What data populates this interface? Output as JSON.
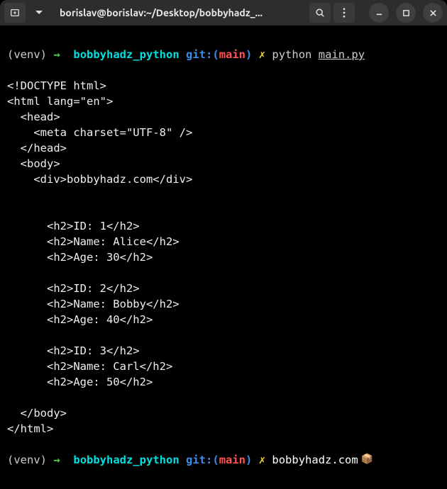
{
  "titlebar": {
    "title": "borislav@borislav:~/Desktop/bobbyhadz_..."
  },
  "prompt1": {
    "venv": "(venv)",
    "arrow": "→",
    "dir": "bobbyhadz_python",
    "git_label": "git:(",
    "branch": "main",
    "git_close": ")",
    "x": "✗",
    "command": "python",
    "file": "main.py"
  },
  "output_lines": [
    "<!DOCTYPE html>",
    "<html lang=\"en\">",
    "  <head>",
    "    <meta charset=\"UTF-8\" />",
    "  </head>",
    "  <body>",
    "    <div>bobbyhadz.com</div>",
    "",
    "    ",
    "      <h2>ID: 1</h2>",
    "      <h2>Name: Alice</h2>",
    "      <h2>Age: 30</h2>",
    "    ",
    "      <h2>ID: 2</h2>",
    "      <h2>Name: Bobby</h2>",
    "      <h2>Age: 40</h2>",
    "    ",
    "      <h2>ID: 3</h2>",
    "      <h2>Name: Carl</h2>",
    "      <h2>Age: 50</h2>",
    "    ",
    "  </body>",
    "</html>"
  ],
  "prompt2": {
    "venv": "(venv)",
    "arrow": "→",
    "dir": "bobbyhadz_python",
    "git_label": "git:(",
    "branch": "main",
    "git_close": ")",
    "x": "✗"
  },
  "watermark": {
    "text": "bobbyhadz.com",
    "cube": "📦"
  }
}
